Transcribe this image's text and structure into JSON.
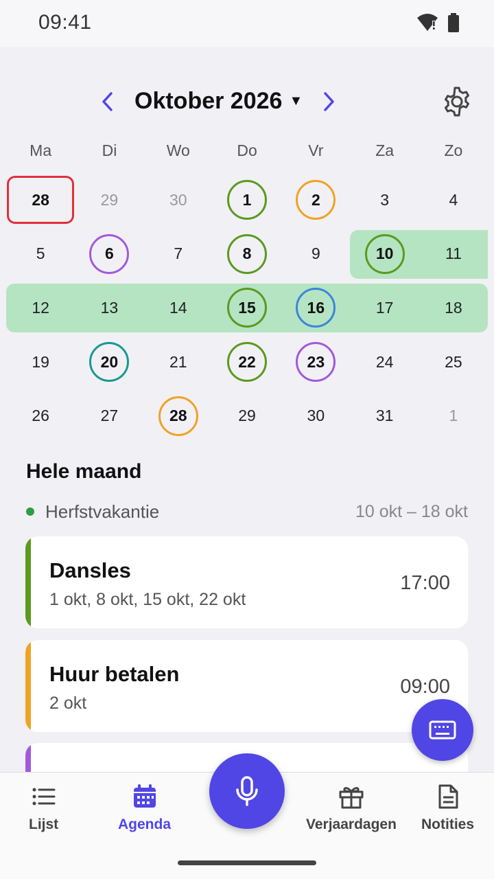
{
  "status_bar": {
    "time": "09:41"
  },
  "calendar": {
    "month_label": "Oktober 2026",
    "weekdays": [
      "Ma",
      "Di",
      "Wo",
      "Do",
      "Vr",
      "Za",
      "Zo"
    ],
    "weeks": [
      [
        {
          "d": "28",
          "muted": false,
          "bold": true,
          "today": true
        },
        {
          "d": "29",
          "muted": true
        },
        {
          "d": "30",
          "muted": true
        },
        {
          "d": "1",
          "bold": true,
          "ring": "#5a9a1e"
        },
        {
          "d": "2",
          "bold": true,
          "ring": "#f0a224"
        },
        {
          "d": "3"
        },
        {
          "d": "4"
        }
      ],
      [
        {
          "d": "5"
        },
        {
          "d": "6",
          "bold": true,
          "ring": "#a259d9"
        },
        {
          "d": "7"
        },
        {
          "d": "8",
          "bold": true,
          "ring": "#5a9a1e"
        },
        {
          "d": "9"
        },
        {
          "d": "10",
          "bold": true,
          "ring": "#5a9a1e"
        },
        {
          "d": "11"
        }
      ],
      [
        {
          "d": "12"
        },
        {
          "d": "13"
        },
        {
          "d": "14"
        },
        {
          "d": "15",
          "bold": true,
          "ring": "#5a9a1e"
        },
        {
          "d": "16",
          "bold": true,
          "ring": "#3b86d9"
        },
        {
          "d": "17"
        },
        {
          "d": "18"
        }
      ],
      [
        {
          "d": "19"
        },
        {
          "d": "20",
          "bold": true,
          "ring": "#17998f"
        },
        {
          "d": "21"
        },
        {
          "d": "22",
          "bold": true,
          "ring": "#5a9a1e"
        },
        {
          "d": "23",
          "bold": true,
          "ring": "#a259d9"
        },
        {
          "d": "24"
        },
        {
          "d": "25"
        }
      ],
      [
        {
          "d": "26"
        },
        {
          "d": "27"
        },
        {
          "d": "28",
          "bold": true,
          "ring": "#f0a224"
        },
        {
          "d": "29"
        },
        {
          "d": "30"
        },
        {
          "d": "31"
        },
        {
          "d": "1",
          "muted": true
        }
      ]
    ]
  },
  "month_section": {
    "title": "Hele maand",
    "holiday": {
      "name": "Herfstvakantie",
      "range": "10 okt – 18 okt",
      "color": "#2e9e44"
    }
  },
  "events": [
    {
      "title": "Dansles",
      "dates": "1 okt, 8 okt, 15 okt, 22 okt",
      "time": "17:00",
      "color": "#5a9a1e"
    },
    {
      "title": "Huur betalen",
      "dates": "2 okt",
      "time": "09:00",
      "color": "#f0a224"
    }
  ],
  "partial_event_color": "#a259d9",
  "bottom_nav": {
    "items": [
      {
        "label": "Lijst",
        "icon": "list-icon",
        "active": false
      },
      {
        "label": "Agenda",
        "icon": "calendar-icon",
        "active": true
      },
      {
        "label": "Verjaardagen",
        "icon": "gift-icon",
        "active": false
      },
      {
        "label": "Notities",
        "icon": "notes-icon",
        "active": false
      }
    ]
  },
  "colors": {
    "accent": "#5046e5",
    "today": "#e0303a",
    "holiday_band": "#b5e4c3"
  }
}
